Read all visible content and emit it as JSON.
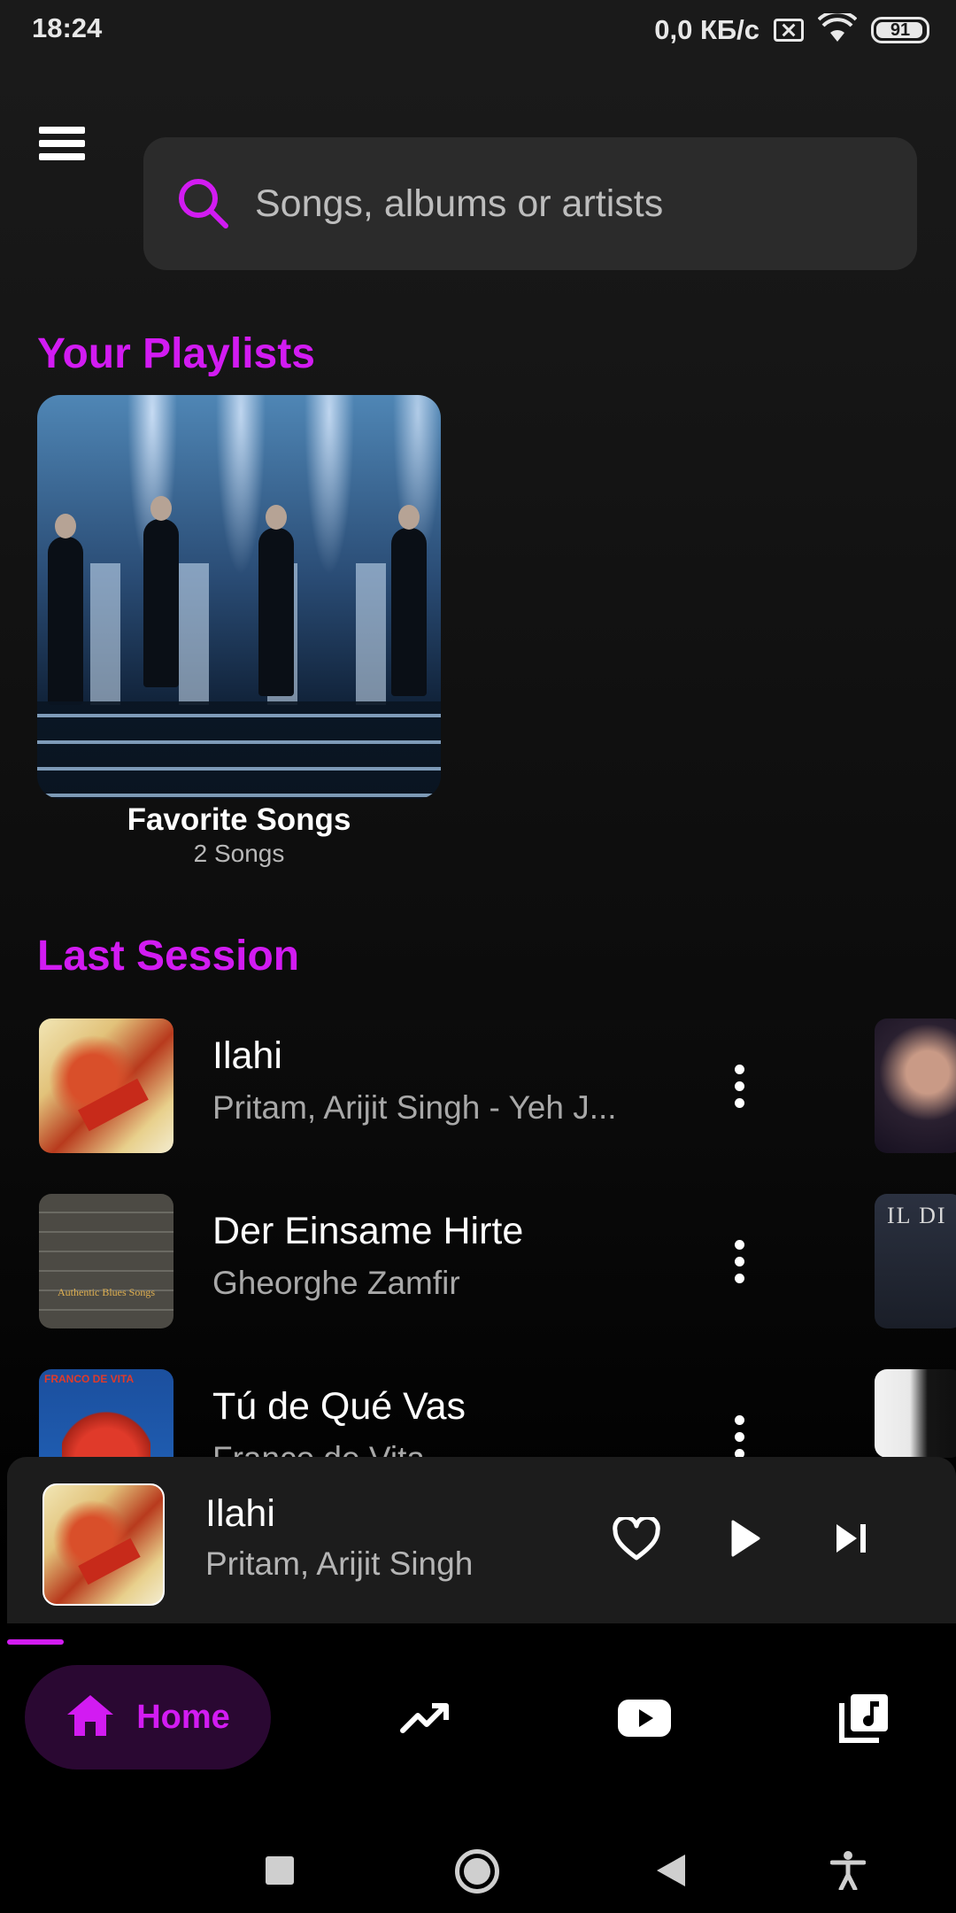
{
  "status_bar": {
    "time": "18:24",
    "speed": "0,0 КБ/с",
    "battery": "91",
    "icons": [
      "no-sim-icon",
      "wifi-icon",
      "battery-icon"
    ]
  },
  "header": {
    "menu_icon": "hamburger-menu-icon",
    "search": {
      "placeholder": "Songs, albums or artists",
      "icon": "search-icon"
    }
  },
  "playlists": {
    "title": "Your Playlists",
    "items": [
      {
        "name": "Favorite Songs",
        "count": "2 Songs"
      }
    ]
  },
  "last_session": {
    "title": "Last Session",
    "songs": [
      {
        "title": "Ilahi",
        "artist": "Pritam, Arijit Singh - Yeh J..."
      },
      {
        "title": "Der Einsame Hirte",
        "artist": "Gheorghe Zamfir",
        "cover_text": "Authentic Blues Songs"
      },
      {
        "title": "Tú de Qué Vas",
        "artist": "Franco de Vita",
        "cover_text": "FRANCO DE VITA"
      }
    ],
    "side_thumb_text": "IL DI"
  },
  "now_playing": {
    "title": "Ilahi",
    "artist": "Pritam, Arijit Singh",
    "progress": 0.06,
    "controls": [
      "heart-icon",
      "play-icon",
      "skip-next-icon"
    ]
  },
  "bottom_nav": {
    "items": [
      {
        "label": "Home",
        "icon": "home-icon",
        "active": true
      },
      {
        "label": "",
        "icon": "trending-icon"
      },
      {
        "label": "",
        "icon": "youtube-icon"
      },
      {
        "label": "",
        "icon": "library-music-icon"
      }
    ]
  },
  "colors": {
    "accent": "#d21bf2",
    "background": "#0f0f0f",
    "surface": "#2b2b2b",
    "active_pill": "#2a0832"
  }
}
